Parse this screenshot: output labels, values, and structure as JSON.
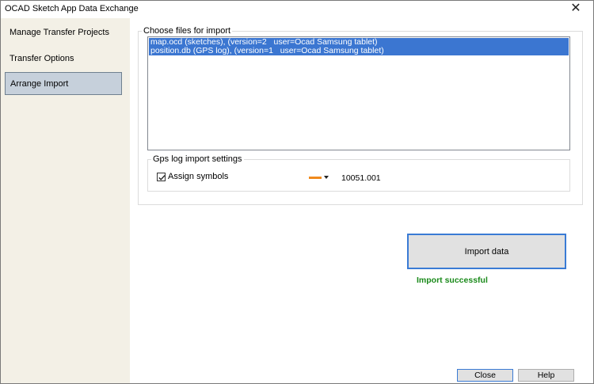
{
  "window": {
    "title": "OCAD Sketch App Data Exchange",
    "close_glyph": "✕"
  },
  "sidebar": {
    "items": [
      {
        "label": "Manage Transfer Projects",
        "active": false
      },
      {
        "label": "Transfer Options",
        "active": false
      },
      {
        "label": "Arrange Import",
        "active": true
      }
    ]
  },
  "import_files": {
    "title": "Choose files for import",
    "files": [
      "map.ocd (sketches), (version=2   user=Ocad Samsung tablet)",
      "position.db (GPS log), (version=1   user=Ocad Samsung tablet)"
    ]
  },
  "gps_settings": {
    "title": "Gps log import settings",
    "assign_symbols_label": "Assign symbols",
    "assign_symbols_checked": true,
    "symbol_color": "#f08a1c",
    "symbol_code": "10051.001"
  },
  "actions": {
    "import_label": "Import data",
    "status_text": "Import successful",
    "status_color": "#1a8a1a"
  },
  "footer": {
    "close_label": "Close",
    "help_label": "Help"
  }
}
